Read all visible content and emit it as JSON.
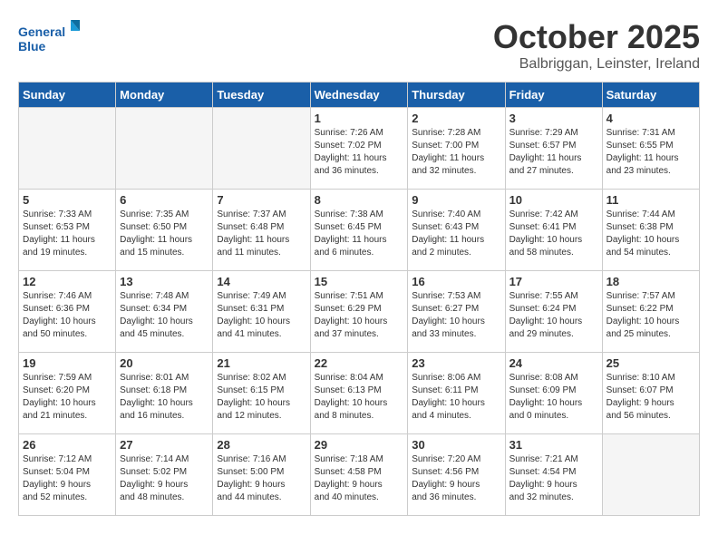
{
  "header": {
    "logo_line1": "General",
    "logo_line2": "Blue",
    "month": "October 2025",
    "location": "Balbriggan, Leinster, Ireland"
  },
  "weekdays": [
    "Sunday",
    "Monday",
    "Tuesday",
    "Wednesday",
    "Thursday",
    "Friday",
    "Saturday"
  ],
  "weeks": [
    [
      {
        "day": "",
        "info": ""
      },
      {
        "day": "",
        "info": ""
      },
      {
        "day": "",
        "info": ""
      },
      {
        "day": "1",
        "info": "Sunrise: 7:26 AM\nSunset: 7:02 PM\nDaylight: 11 hours\nand 36 minutes."
      },
      {
        "day": "2",
        "info": "Sunrise: 7:28 AM\nSunset: 7:00 PM\nDaylight: 11 hours\nand 32 minutes."
      },
      {
        "day": "3",
        "info": "Sunrise: 7:29 AM\nSunset: 6:57 PM\nDaylight: 11 hours\nand 27 minutes."
      },
      {
        "day": "4",
        "info": "Sunrise: 7:31 AM\nSunset: 6:55 PM\nDaylight: 11 hours\nand 23 minutes."
      }
    ],
    [
      {
        "day": "5",
        "info": "Sunrise: 7:33 AM\nSunset: 6:53 PM\nDaylight: 11 hours\nand 19 minutes."
      },
      {
        "day": "6",
        "info": "Sunrise: 7:35 AM\nSunset: 6:50 PM\nDaylight: 11 hours\nand 15 minutes."
      },
      {
        "day": "7",
        "info": "Sunrise: 7:37 AM\nSunset: 6:48 PM\nDaylight: 11 hours\nand 11 minutes."
      },
      {
        "day": "8",
        "info": "Sunrise: 7:38 AM\nSunset: 6:45 PM\nDaylight: 11 hours\nand 6 minutes."
      },
      {
        "day": "9",
        "info": "Sunrise: 7:40 AM\nSunset: 6:43 PM\nDaylight: 11 hours\nand 2 minutes."
      },
      {
        "day": "10",
        "info": "Sunrise: 7:42 AM\nSunset: 6:41 PM\nDaylight: 10 hours\nand 58 minutes."
      },
      {
        "day": "11",
        "info": "Sunrise: 7:44 AM\nSunset: 6:38 PM\nDaylight: 10 hours\nand 54 minutes."
      }
    ],
    [
      {
        "day": "12",
        "info": "Sunrise: 7:46 AM\nSunset: 6:36 PM\nDaylight: 10 hours\nand 50 minutes."
      },
      {
        "day": "13",
        "info": "Sunrise: 7:48 AM\nSunset: 6:34 PM\nDaylight: 10 hours\nand 45 minutes."
      },
      {
        "day": "14",
        "info": "Sunrise: 7:49 AM\nSunset: 6:31 PM\nDaylight: 10 hours\nand 41 minutes."
      },
      {
        "day": "15",
        "info": "Sunrise: 7:51 AM\nSunset: 6:29 PM\nDaylight: 10 hours\nand 37 minutes."
      },
      {
        "day": "16",
        "info": "Sunrise: 7:53 AM\nSunset: 6:27 PM\nDaylight: 10 hours\nand 33 minutes."
      },
      {
        "day": "17",
        "info": "Sunrise: 7:55 AM\nSunset: 6:24 PM\nDaylight: 10 hours\nand 29 minutes."
      },
      {
        "day": "18",
        "info": "Sunrise: 7:57 AM\nSunset: 6:22 PM\nDaylight: 10 hours\nand 25 minutes."
      }
    ],
    [
      {
        "day": "19",
        "info": "Sunrise: 7:59 AM\nSunset: 6:20 PM\nDaylight: 10 hours\nand 21 minutes."
      },
      {
        "day": "20",
        "info": "Sunrise: 8:01 AM\nSunset: 6:18 PM\nDaylight: 10 hours\nand 16 minutes."
      },
      {
        "day": "21",
        "info": "Sunrise: 8:02 AM\nSunset: 6:15 PM\nDaylight: 10 hours\nand 12 minutes."
      },
      {
        "day": "22",
        "info": "Sunrise: 8:04 AM\nSunset: 6:13 PM\nDaylight: 10 hours\nand 8 minutes."
      },
      {
        "day": "23",
        "info": "Sunrise: 8:06 AM\nSunset: 6:11 PM\nDaylight: 10 hours\nand 4 minutes."
      },
      {
        "day": "24",
        "info": "Sunrise: 8:08 AM\nSunset: 6:09 PM\nDaylight: 10 hours\nand 0 minutes."
      },
      {
        "day": "25",
        "info": "Sunrise: 8:10 AM\nSunset: 6:07 PM\nDaylight: 9 hours\nand 56 minutes."
      }
    ],
    [
      {
        "day": "26",
        "info": "Sunrise: 7:12 AM\nSunset: 5:04 PM\nDaylight: 9 hours\nand 52 minutes."
      },
      {
        "day": "27",
        "info": "Sunrise: 7:14 AM\nSunset: 5:02 PM\nDaylight: 9 hours\nand 48 minutes."
      },
      {
        "day": "28",
        "info": "Sunrise: 7:16 AM\nSunset: 5:00 PM\nDaylight: 9 hours\nand 44 minutes."
      },
      {
        "day": "29",
        "info": "Sunrise: 7:18 AM\nSunset: 4:58 PM\nDaylight: 9 hours\nand 40 minutes."
      },
      {
        "day": "30",
        "info": "Sunrise: 7:20 AM\nSunset: 4:56 PM\nDaylight: 9 hours\nand 36 minutes."
      },
      {
        "day": "31",
        "info": "Sunrise: 7:21 AM\nSunset: 4:54 PM\nDaylight: 9 hours\nand 32 minutes."
      },
      {
        "day": "",
        "info": ""
      }
    ]
  ]
}
